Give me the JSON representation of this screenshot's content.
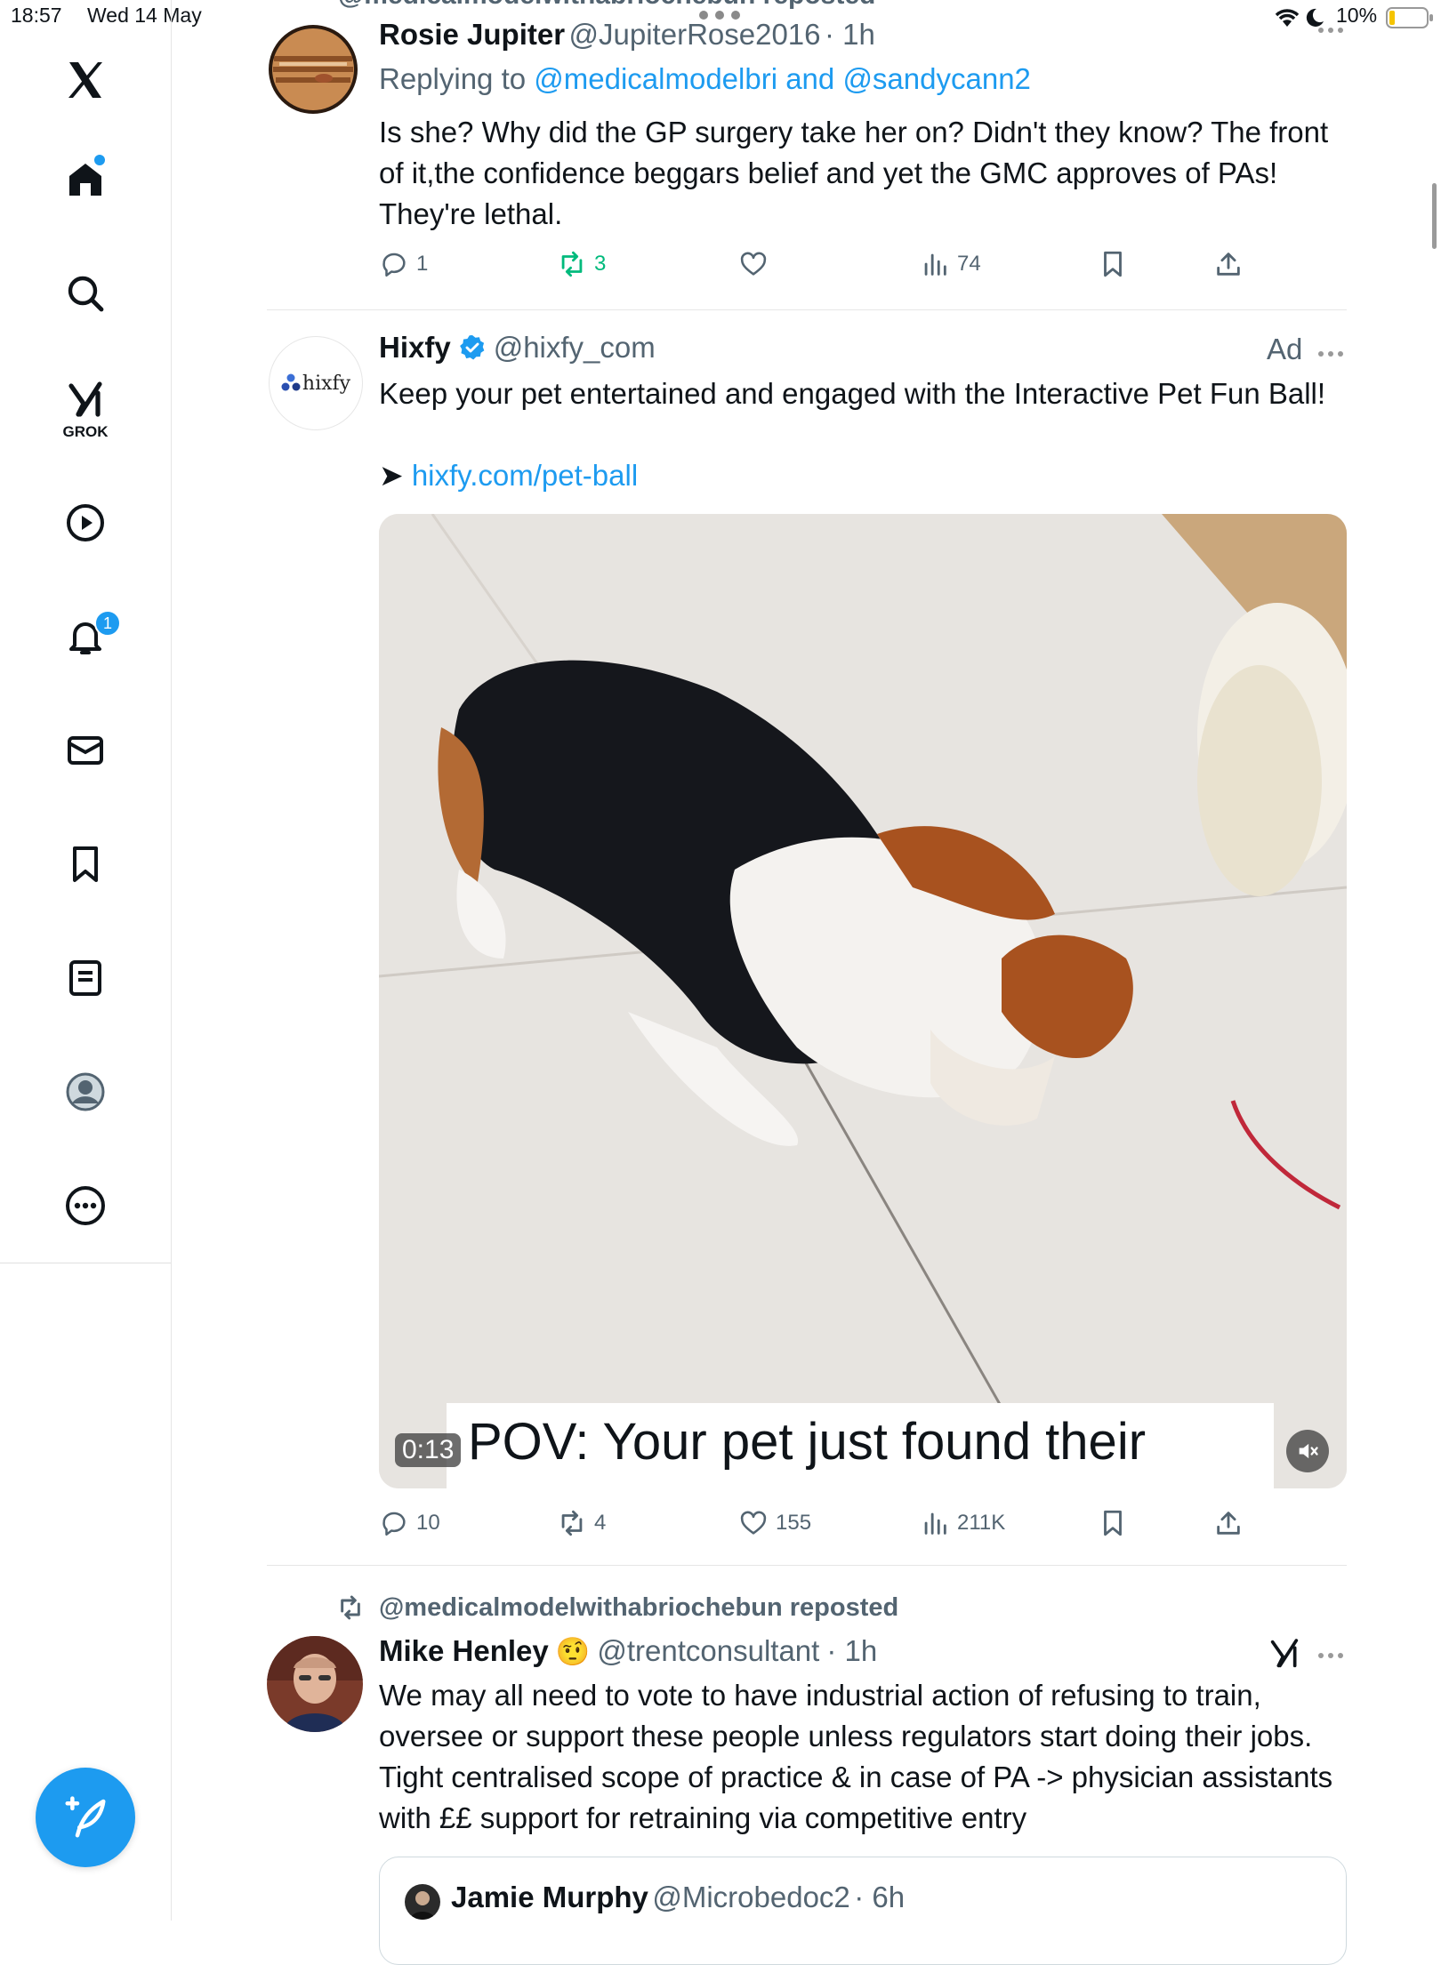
{
  "status_bar": {
    "time": "18:57",
    "date": "Wed 14 May",
    "battery": "10%"
  },
  "sidebar": {
    "grok_label": "GROK",
    "notifications_count": "1"
  },
  "top_repost_header": "@medicalmodelwithabriochebun reposted",
  "tweet1": {
    "name": "Rosie Jupiter",
    "handle": "@JupiterRose2016",
    "time": "· 1h",
    "replying_prefix": "Replying to ",
    "replying_user1": "@medicalmodelbri",
    "replying_and": " and ",
    "replying_user2": "@sandycann2",
    "text": "Is she? Why did the GP surgery take her on? Didn't they know? The front of it,the confidence beggars belief and yet the GMC approves of PAs! They're lethal.",
    "replies": "1",
    "reposts": "3",
    "views": "74"
  },
  "tweet2": {
    "name": "Hixfy",
    "handle": "@hixfy_com",
    "ad_label": "Ad",
    "avatar_text": "hixfy",
    "text": "Keep your pet entertained and engaged with the Interactive Pet Fun Ball!",
    "link_arrow": "➤",
    "link": "hixfy.com/pet-ball",
    "video_time": "0:13",
    "video_caption": "POV: Your pet just found their",
    "replies": "10",
    "reposts": "4",
    "likes": "155",
    "views": "211K"
  },
  "tweet3": {
    "repost_header": "@medicalmodelwithabriochebun reposted",
    "name": "Mike Henley",
    "emoji": "🤨",
    "handle": "@trentconsultant",
    "time": "· 1h",
    "text": "We may all need to vote to have industrial action of refusing to train, oversee or support these people unless regulators start doing their jobs. Tight centralised scope of practice & in case of PA -> physician assistants with ££ support for retraining via competitive entry"
  },
  "quoted": {
    "name": "Jamie Murphy",
    "handle": "@Microbedoc2",
    "time": "· 6h"
  },
  "colors": {
    "accent": "#1d9bf0",
    "repost_green": "#00ba7c",
    "muted": "#536471"
  }
}
